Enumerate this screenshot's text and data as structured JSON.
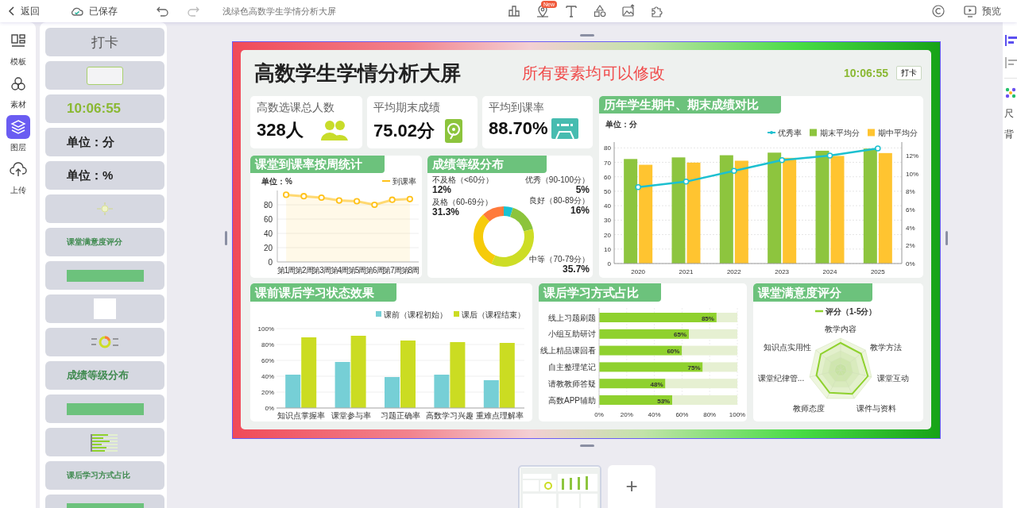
{
  "toolbar": {
    "back": "返回",
    "save_status": "已保存",
    "doc_title": "浅绿色高数学生学情分析大屏",
    "new_badge": "New",
    "preview": "预览"
  },
  "rail": [
    {
      "label": "模板",
      "selected": false
    },
    {
      "label": "素材",
      "selected": false
    },
    {
      "label": "图层",
      "selected": true
    },
    {
      "label": "上传",
      "selected": false
    }
  ],
  "layers": [
    {
      "kind": "title",
      "text": "打卡"
    },
    {
      "kind": "box"
    },
    {
      "kind": "clock",
      "text": "10:06:55"
    },
    {
      "kind": "text",
      "text": "单位：分"
    },
    {
      "kind": "text",
      "text": "单位：%"
    },
    {
      "kind": "thumb-line"
    },
    {
      "kind": "label",
      "text": "课堂满意度评分"
    },
    {
      "kind": "bar"
    },
    {
      "kind": "square"
    },
    {
      "kind": "thumb-donut"
    },
    {
      "kind": "heading",
      "text": "成绩等级分布"
    },
    {
      "kind": "bar"
    },
    {
      "kind": "thumb-bars"
    },
    {
      "kind": "label",
      "text": "课后学习方式占比"
    },
    {
      "kind": "bar"
    }
  ],
  "dashboard": {
    "title": "高数学生学情分析大屏",
    "note": "所有要素均可以修改",
    "clock": "10:06:55",
    "checkin_button": "打卡",
    "kpis": [
      {
        "label": "高数选课总人数",
        "value": "328人",
        "kind": "people"
      },
      {
        "label": "平均期末成绩",
        "value": "75.02分",
        "kind": "disk"
      },
      {
        "label": "平均到课率",
        "value": "88.70%",
        "kind": "cassette"
      }
    ],
    "attendance": {
      "title": "课堂到课率按周统计",
      "unit": "单位：%",
      "chart_data": {
        "type": "area",
        "categories": [
          "第1周",
          "第2周",
          "第3周",
          "第4周",
          "第5周",
          "第6周",
          "第7周",
          "第8周"
        ],
        "series": [
          {
            "name": "到课率",
            "color": "#ffc21a",
            "marker": true,
            "values": [
              94,
              92,
              90,
              86,
              85,
              80,
              87,
              88
            ]
          }
        ],
        "ylim": [
          0,
          100
        ],
        "yticks": [
          0,
          20,
          40,
          60,
          80
        ],
        "grid": true,
        "legend": "top-right"
      }
    },
    "grades": {
      "title": "成绩等级分布",
      "chart_data": {
        "type": "donut",
        "categories": [
          "优秀（90-100分）",
          "良好（80-89分）",
          "中等（70-79分）",
          "及格（60-69分）",
          "不及格（<60分）"
        ],
        "values": [
          5,
          16,
          35.7,
          31.3,
          12
        ],
        "colors": [
          "#19c3d3",
          "#8cc43c",
          "#cddd26",
          "#f6cb0a",
          "#ff7a3c"
        ],
        "value_labels": [
          "5%",
          "16%",
          "35.7%",
          "31.3%",
          "12%"
        ]
      }
    },
    "yearly": {
      "title": "历年学生期中、期末成绩对比",
      "unit": "单位：分",
      "chart_data": {
        "type": "bar",
        "categories": [
          "2020",
          "2021",
          "2022",
          "2023",
          "2024",
          "2025"
        ],
        "series": [
          {
            "name": "优秀率",
            "type": "line",
            "axis": "y2",
            "marker": true,
            "color": "#1cc0d0",
            "values": [
              8.5,
              9.1,
              10.3,
              11.5,
              12,
              12.8
            ]
          },
          {
            "name": "期末平均分",
            "color": "#8dc53e",
            "values": [
              72.3,
              73.4,
              74.9,
              76.7,
              78,
              79.5
            ]
          },
          {
            "name": "期中平均分",
            "color": "#ffc430",
            "values": [
              68.3,
              69.8,
              71.1,
              73.1,
              74.4,
              76.4
            ]
          }
        ],
        "ylim": [
          0,
          84
        ],
        "yticks": [
          0,
          10,
          20,
          30,
          40,
          50,
          60,
          70,
          80
        ],
        "y2lim": [
          0,
          13.5
        ],
        "y2ticks": [
          {
            "value": 0,
            "label": "0%"
          },
          {
            "value": 2,
            "label": "2%"
          },
          {
            "value": 4,
            "label": "4%"
          },
          {
            "value": 6,
            "label": "6%"
          },
          {
            "value": 8,
            "label": "8%"
          },
          {
            "value": 10,
            "label": "10%"
          },
          {
            "value": 12,
            "label": "12%"
          }
        ],
        "grid": true,
        "legend": "top-right"
      }
    },
    "before_after": {
      "title": "课前课后学习状态效果",
      "chart_data": {
        "type": "bar",
        "categories": [
          "知识点掌握率",
          "课堂参与率",
          "习题正确率",
          "高数学习兴趣",
          "重难点理解率"
        ],
        "series": [
          {
            "name": "课前（课程初始）",
            "color": "#76cfd6",
            "values": [
              42,
              58,
              39,
              42,
              35
            ]
          },
          {
            "name": "课后（课程结束）",
            "color": "#cbdc22",
            "values": [
              89,
              91,
              85,
              83,
              82
            ]
          }
        ],
        "ylim": [
          0,
          100
        ],
        "yticks": [
          {
            "value": 0,
            "label": "0%"
          },
          {
            "value": 20,
            "label": "20%"
          },
          {
            "value": 40,
            "label": "40%"
          },
          {
            "value": 60,
            "label": "60%"
          },
          {
            "value": 80,
            "label": "80%"
          },
          {
            "value": 100,
            "label": "100%"
          }
        ],
        "grid": true,
        "legend": "top-right"
      }
    },
    "study_modes": {
      "title": "课后学习方式占比",
      "chart_data": {
        "type": "bar",
        "orientation": "horizontal",
        "categories": [
          "线上习题刷题",
          "小组互助研讨",
          "线上精品课回看",
          "自主整理笔记",
          "请教教师答疑",
          "高数APP辅助"
        ],
        "series": [
          {
            "color": "#8fd12e",
            "values": [
              85,
              65,
              60,
              75,
              48,
              53
            ]
          },
          {
            "color": "#e6f0d2",
            "values": [
              15,
              35,
              40,
              25,
              52,
              47
            ]
          }
        ],
        "stacked": true,
        "value_labels": [
          "85%",
          "65%",
          "60%",
          "75%",
          "48%",
          "53%"
        ],
        "xlim": [
          0,
          100
        ],
        "xticks": [
          {
            "value": 0,
            "label": "0%"
          },
          {
            "value": 20,
            "label": "20%"
          },
          {
            "value": 40,
            "label": "40%"
          },
          {
            "value": 60,
            "label": "60%"
          },
          {
            "value": 80,
            "label": "80%"
          },
          {
            "value": 100,
            "label": "100%"
          }
        ],
        "grid": true
      }
    },
    "satisfaction": {
      "title": "课堂满意度评分",
      "legend": "评分（1-5分）",
      "axes": [
        "教学内容",
        "教学方法",
        "课堂互动",
        "课件与资料",
        "教师态度",
        "课堂纪律管...",
        "知识点实用性"
      ]
    }
  },
  "add_page": "+",
  "right_panel": [
    "尺",
    "背"
  ]
}
